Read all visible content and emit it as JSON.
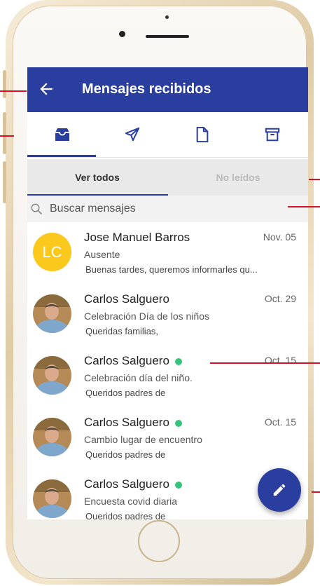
{
  "header": {
    "title": "Mensajes recibidos"
  },
  "tabs": [
    {
      "icon": "inbox-icon"
    },
    {
      "icon": "send-icon"
    },
    {
      "icon": "document-icon"
    },
    {
      "icon": "archive-icon"
    }
  ],
  "subtabs": {
    "all": "Ver todos",
    "unread": "No leídos"
  },
  "search": {
    "placeholder": "Buscar mensajes"
  },
  "messages": [
    {
      "sender": "Jose Manuel Barros",
      "initials": "LC",
      "date": "Nov. 05",
      "subject": "Ausente",
      "preview": "Buenas tardes, queremos informarles qu...",
      "online": false
    },
    {
      "sender": "Carlos Salguero",
      "date": "Oct. 29",
      "subject": "Celebración Día de los niños",
      "preview": "Queridas familias,",
      "online": false
    },
    {
      "sender": "Carlos Salguero",
      "date": "Oct. 15",
      "subject": "Celebración día del niño.",
      "preview": "Queridos padres de",
      "online": true
    },
    {
      "sender": "Carlos Salguero",
      "date": "Oct. 15",
      "subject": "Cambio lugar de encuentro",
      "preview": "Queridos padres de",
      "online": true
    },
    {
      "sender": "Carlos Salguero",
      "date": "",
      "subject": "Encuesta covid diaria",
      "preview": "Queridos padres de",
      "online": true
    }
  ],
  "colors": {
    "primary": "#2a3e9f",
    "online": "#35c27a",
    "initials_bg": "#fbc91e",
    "callout": "#d01428"
  }
}
